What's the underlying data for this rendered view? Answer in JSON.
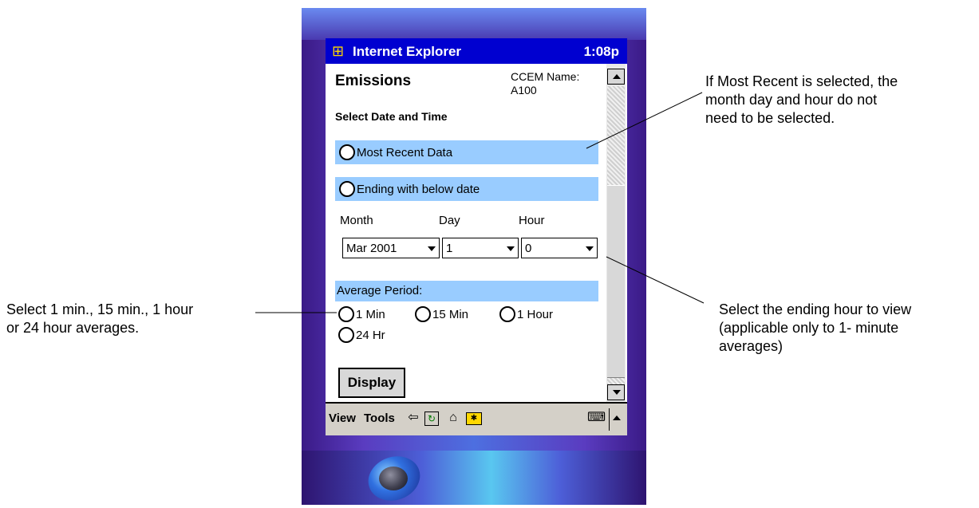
{
  "titlebar": {
    "app_title": "Internet Explorer",
    "clock": "1:08p",
    "app_icon": "ie-windows-flag-icon"
  },
  "page": {
    "heading": "Emissions",
    "ccem_line1": "CCEM Name:",
    "ccem_line2": "A100",
    "subheading": "Select Date and Time"
  },
  "date_options": {
    "most_recent": "Most Recent Data",
    "ending_with": "Ending with below date"
  },
  "date_fields": {
    "month_label": "Month",
    "day_label": "Day",
    "hour_label": "Hour",
    "month_value": "Mar 2001",
    "day_value": "1",
    "hour_value": "0"
  },
  "average": {
    "label": "Average Period:",
    "options": [
      "1 Min",
      "15 Min",
      "1 Hour",
      "24 Hr"
    ]
  },
  "display_button": "Display",
  "command_bar": {
    "view": "View",
    "tools": "Tools"
  },
  "annotations": {
    "most_recent_1": "If Most Recent is selected, the",
    "most_recent_2": "month day and hour do not",
    "most_recent_3": "need to be selected.",
    "average_1": "Select 1 min., 15 min., 1 hour",
    "average_2": "or 24 hour averages.",
    "hour_1": "Select the ending hour to view",
    "hour_2": "(applicable only to 1- minute",
    "hour_3": "averages)"
  },
  "colors": {
    "title_blue": "#0000d0",
    "highlight": "#99ccff",
    "device_purple": "#3a1a86"
  }
}
